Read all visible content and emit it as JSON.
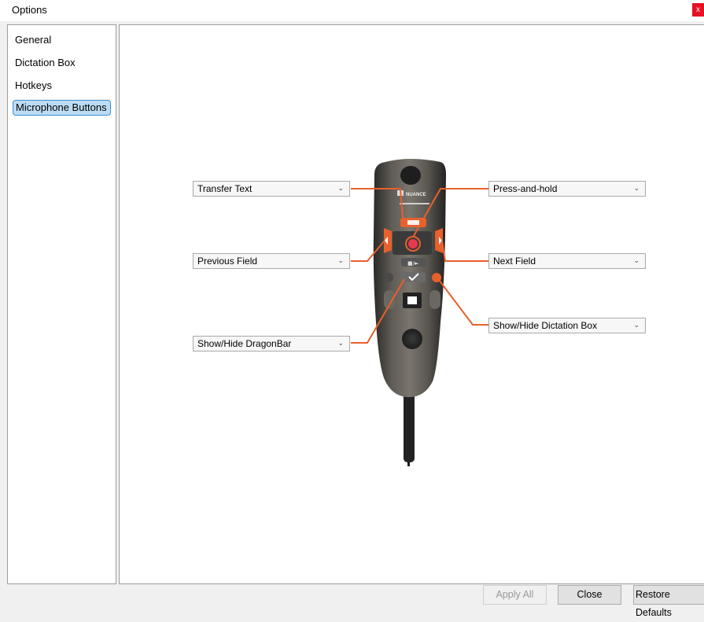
{
  "window": {
    "title": "Options",
    "close_glyph": "x"
  },
  "sidebar": {
    "items": [
      {
        "label": "General"
      },
      {
        "label": "Dictation Box"
      },
      {
        "label": "Hotkeys"
      },
      {
        "label": "Microphone Buttons",
        "selected": true
      }
    ]
  },
  "mappings": {
    "transfer_text": "Transfer Text",
    "press_and_hold": "Press-and-hold",
    "previous_field": "Previous Field",
    "next_field": "Next Field",
    "show_hide_dictation_box": "Show/Hide Dictation Box",
    "show_hide_dragonbar": "Show/Hide DragonBar"
  },
  "device": {
    "brand_text": "NUANCE"
  },
  "buttons": {
    "apply_all": "Apply All",
    "close": "Close",
    "restore_defaults": "Restore Defaults"
  },
  "colors": {
    "accent_orange": "#e8602c",
    "selection_blue": "#bcdcf4",
    "close_red": "#e81123"
  }
}
